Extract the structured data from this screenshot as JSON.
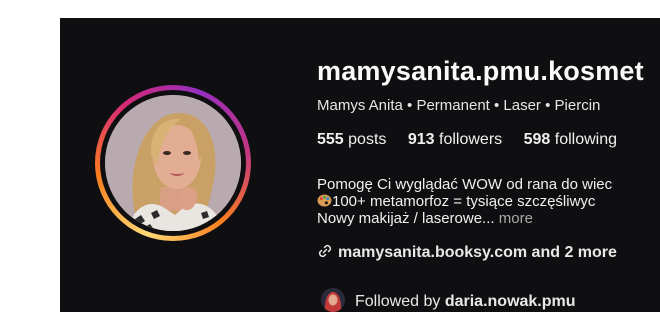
{
  "profile": {
    "username": "mamysanita.pmu.kosmet",
    "full_name": "Mamys Anita • Permanent • Laser • Piercin",
    "stats": [
      {
        "count": "555",
        "label": "posts"
      },
      {
        "count": "913",
        "label": "followers"
      },
      {
        "count": "598",
        "label": "following"
      }
    ],
    "bio": {
      "line1": "Pomogę Ci wyglądać WOW od rana do wiec",
      "line2": "100+ metamorfoz = tysiące szczęśliwyc",
      "line3": "Nowy makijaż / laserowe...",
      "more": "more",
      "emoji_icon": "palette-emoji"
    },
    "link": {
      "text": "mamysanita.booksy.com and 2 more",
      "icon": "link-icon"
    },
    "followed_by": {
      "prefix": "Followed by",
      "user": "daria.nowak.pmu"
    }
  },
  "colors": {
    "background": "#0f0f12",
    "story_ring": [
      "#feda75",
      "#fa7e1e",
      "#d62976",
      "#962fbf"
    ],
    "text": "#f5f5f5",
    "muted": "#a8a8a8"
  }
}
